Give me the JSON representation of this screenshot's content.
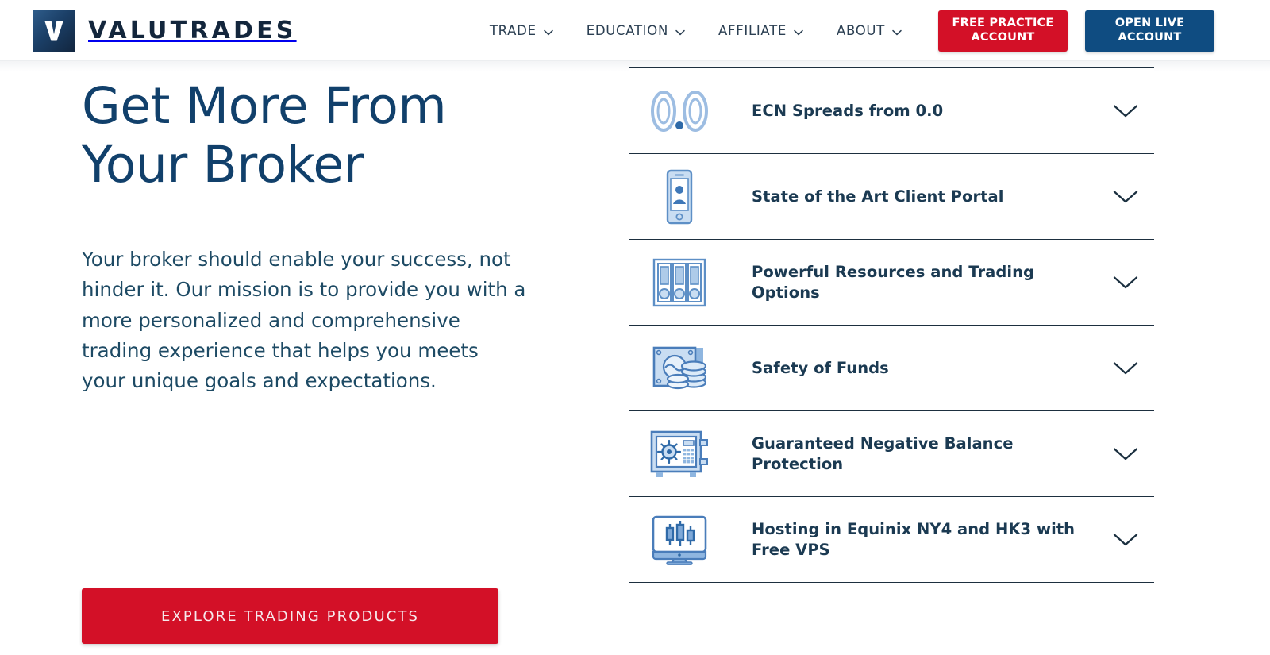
{
  "header": {
    "brand": {
      "mark_icon": "valutrades-v-logomark",
      "wordmark": "VALUTRADES"
    },
    "nav": [
      {
        "label": "TRADE",
        "icon": "chevron-down-icon"
      },
      {
        "label": "EDUCATION",
        "icon": "chevron-down-icon"
      },
      {
        "label": "AFFILIATE",
        "icon": "chevron-down-icon"
      },
      {
        "label": "ABOUT",
        "icon": "chevron-down-icon"
      }
    ],
    "cta": {
      "practice_label": "FREE PRACTICE ACCOUNT",
      "practice_color": "#d31027",
      "live_label": "OPEN LIVE ACCOUNT",
      "live_color": "#0f4c81"
    }
  },
  "hero": {
    "headline": "Get More From Your Broker",
    "body": "Your broker should enable your success, not hinder it. Our mission is to provide you with a more personalized and comprehensive trading experience that helps you meets your unique goals and expectations.",
    "cta_label": "EXPLORE TRADING PRODUCTS",
    "cta_color": "#d31027"
  },
  "accordion": {
    "items": [
      {
        "label": "ECN Spreads from 0.0",
        "icon": "zero-point-zero-icon",
        "chevron": "chevron-down-icon",
        "expanded": "false"
      },
      {
        "label": "State of the Art Client Portal",
        "icon": "smartphone-user-icon",
        "chevron": "chevron-down-icon",
        "expanded": "false"
      },
      {
        "label": "Powerful Resources and Trading Options",
        "icon": "binders-shelf-icon",
        "chevron": "chevron-down-icon",
        "expanded": "false"
      },
      {
        "label": "Safety of Funds",
        "icon": "banknote-coins-icon",
        "chevron": "chevron-down-icon",
        "expanded": "false"
      },
      {
        "label": "Guaranteed Negative Balance Protection",
        "icon": "safe-vault-icon",
        "chevron": "chevron-down-icon",
        "expanded": "false"
      },
      {
        "label": "Hosting in Equinix NY4 and HK3 with Free VPS",
        "icon": "monitor-candlestick-chart-icon",
        "chevron": "chevron-down-icon",
        "expanded": "false"
      }
    ]
  },
  "theme": {
    "navy": "#11406b",
    "dark_navy": "#1b3a52",
    "red": "#d31027",
    "icon_blue": "#4a7dba",
    "icon_fill": "#a9c6e8",
    "divider": "#1d2f3f"
  }
}
